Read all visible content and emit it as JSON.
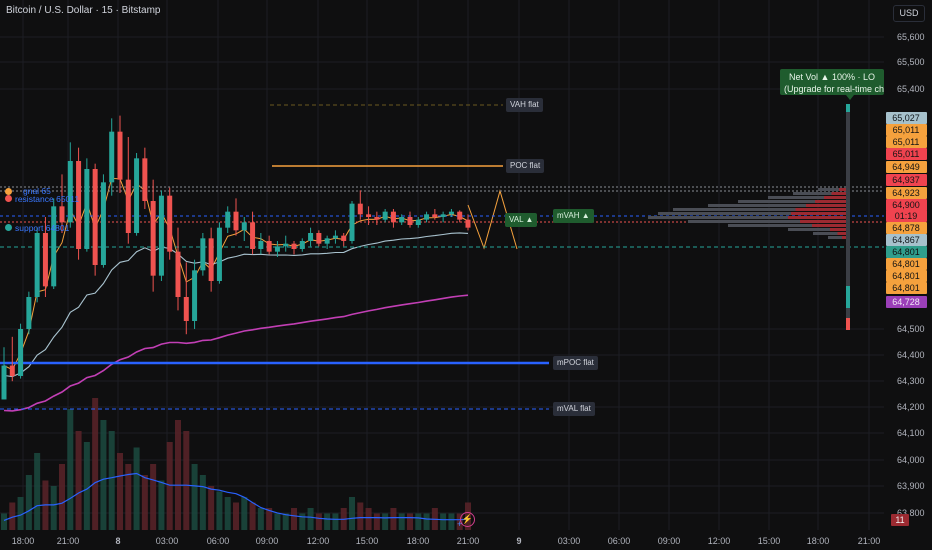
{
  "header": {
    "symbol_line": "Bitcoin / U.S. Dollar · 15 · Bitstamp",
    "currency_button": "USD"
  },
  "net_volume_badge": {
    "line1": "Net Vol ▲ 100%  ·  LO",
    "line2": "(Upgrade for real-time cha"
  },
  "level_labels": {
    "vah": "VAH flat",
    "poc": "POC flat",
    "val": "VAL ▲",
    "mvah": "mVAH ▲",
    "mpoc": "mPOC flat",
    "mval": "mVAL flat"
  },
  "alerts": {
    "resistance_text": "resistance 65011",
    "resistance_overlap": "gnal 65",
    "support_text": "support 64801"
  },
  "price_tags": [
    {
      "text": "65,027",
      "bg": "#a6c1cc",
      "fg": "#10161a"
    },
    {
      "text": "65,011",
      "bg": "#f5a13d",
      "fg": "#141414"
    },
    {
      "text": "65,011",
      "bg": "#f5a13d",
      "fg": "#141414"
    },
    {
      "text": "65,011",
      "bg": "#f0434f",
      "fg": "#141414"
    },
    {
      "text": "64,949",
      "bg": "#f5a13d",
      "fg": "#141414"
    },
    {
      "text": "64,937",
      "bg": "#f0434f",
      "fg": "#141414"
    },
    {
      "text": "64,923",
      "bg": "#f5a13d",
      "fg": "#141414"
    },
    {
      "text": "64,900",
      "bg": "#f0434f",
      "fg": "#141414"
    },
    {
      "text": "01:19",
      "bg": "#f0434f",
      "fg": "#141414"
    },
    {
      "text": "64,878",
      "bg": "#f5a13d",
      "fg": "#141414"
    },
    {
      "text": "64,867",
      "bg": "#a6c1cc",
      "fg": "#10161a"
    },
    {
      "text": "64,801",
      "bg": "#2f9e8c",
      "fg": "#101010"
    },
    {
      "text": "64,801",
      "bg": "#f5a13d",
      "fg": "#141414"
    },
    {
      "text": "64,801",
      "bg": "#f5a13d",
      "fg": "#141414"
    },
    {
      "text": "64,801",
      "bg": "#f5a13d",
      "fg": "#141414"
    },
    {
      "text": "64,728",
      "bg": "#9b3fb8",
      "fg": "#f0e6f5"
    }
  ],
  "volume_tag": "11",
  "colors": {
    "up": "#26a69a",
    "down": "#ef5350",
    "ema_fast": "#f5a13d",
    "ema_mid": "#a6c1cc",
    "ema_slow": "#c23fb5",
    "mpoc": "#2962ff",
    "volume_ma": "#2962ff"
  },
  "chart_data": {
    "type": "candlestick",
    "title": "Bitcoin / U.S. Dollar · 15 · Bitstamp",
    "y_ticks": [
      "65,600",
      "65,500",
      "65,400",
      "64,500",
      "64,400",
      "64,300",
      "64,200",
      "64,100",
      "64,000",
      "63,900",
      "63,800"
    ],
    "x_ticks": [
      "18:00",
      "21:00",
      "8",
      "03:00",
      "06:00",
      "09:00",
      "12:00",
      "15:00",
      "18:00",
      "21:00",
      "9",
      "03:00",
      "06:00",
      "09:00",
      "12:00",
      "15:00",
      "18:00",
      "21:00"
    ],
    "ylim": [
      63750,
      65650
    ],
    "candles": [
      [
        64230,
        64430,
        64230,
        64360
      ],
      [
        64360,
        64470,
        64300,
        64320
      ],
      [
        64320,
        64520,
        64310,
        64500
      ],
      [
        64500,
        64640,
        64480,
        64620
      ],
      [
        64620,
        64880,
        64600,
        64860
      ],
      [
        64860,
        64920,
        64620,
        64660
      ],
      [
        64660,
        64990,
        64650,
        64960
      ],
      [
        64960,
        65080,
        64860,
        64900
      ],
      [
        64900,
        65200,
        64880,
        65130
      ],
      [
        65130,
        65180,
        64760,
        64800
      ],
      [
        64800,
        65140,
        64790,
        65100
      ],
      [
        65100,
        65120,
        64700,
        64740
      ],
      [
        64740,
        65080,
        64730,
        65050
      ],
      [
        65050,
        65290,
        65000,
        65240
      ],
      [
        65240,
        65300,
        65010,
        65060
      ],
      [
        65060,
        65220,
        64820,
        64860
      ],
      [
        64860,
        65160,
        64850,
        65140
      ],
      [
        65140,
        65180,
        64950,
        64980
      ],
      [
        64980,
        65060,
        64640,
        64700
      ],
      [
        64700,
        65020,
        64680,
        65000
      ],
      [
        65000,
        65030,
        64760,
        64790
      ],
      [
        64790,
        64880,
        64570,
        64620
      ],
      [
        64620,
        64750,
        64480,
        64530
      ],
      [
        64530,
        64760,
        64500,
        64720
      ],
      [
        64720,
        64860,
        64700,
        64840
      ],
      [
        64840,
        64880,
        64640,
        64680
      ],
      [
        64680,
        64900,
        64670,
        64880
      ],
      [
        64880,
        64960,
        64860,
        64940
      ],
      [
        64940,
        64990,
        64850,
        64870
      ],
      [
        64870,
        64920,
        64830,
        64900
      ],
      [
        64900,
        64940,
        64780,
        64800
      ],
      [
        64800,
        64860,
        64780,
        64830
      ],
      [
        64830,
        64850,
        64780,
        64790
      ],
      [
        64790,
        64830,
        64770,
        64810
      ],
      [
        64810,
        64850,
        64790,
        64820
      ],
      [
        64820,
        64830,
        64780,
        64800
      ],
      [
        64800,
        64840,
        64790,
        64830
      ],
      [
        64830,
        64880,
        64810,
        64860
      ],
      [
        64860,
        64870,
        64810,
        64820
      ],
      [
        64820,
        64850,
        64800,
        64840
      ],
      [
        64840,
        64870,
        64820,
        64850
      ],
      [
        64850,
        64860,
        64810,
        64830
      ],
      [
        64830,
        64980,
        64820,
        64970
      ],
      [
        64970,
        65020,
        64910,
        64930
      ],
      [
        64930,
        64960,
        64890,
        64920
      ],
      [
        64920,
        64940,
        64890,
        64910
      ],
      [
        64910,
        64950,
        64900,
        64940
      ],
      [
        64940,
        64950,
        64880,
        64900
      ],
      [
        64900,
        64930,
        64890,
        64920
      ],
      [
        64920,
        64940,
        64880,
        64890
      ],
      [
        64890,
        64920,
        64880,
        64910
      ],
      [
        64910,
        64940,
        64900,
        64930
      ],
      [
        64930,
        64950,
        64910,
        64920
      ],
      [
        64920,
        64940,
        64900,
        64930
      ],
      [
        64930,
        64950,
        64920,
        64940
      ],
      [
        64940,
        64945,
        64900,
        64910
      ],
      [
        64910,
        64930,
        64870,
        64880
      ]
    ],
    "volume": [
      3,
      5,
      6,
      10,
      14,
      9,
      8,
      12,
      22,
      18,
      16,
      24,
      20,
      18,
      14,
      12,
      15,
      10,
      12,
      9,
      16,
      20,
      18,
      12,
      10,
      8,
      7,
      6,
      5,
      6,
      5,
      4,
      4,
      3,
      3,
      4,
      3,
      4,
      3,
      3,
      3,
      4,
      6,
      5,
      4,
      3,
      3,
      4,
      3,
      3,
      3,
      3,
      4,
      3,
      3,
      3,
      5
    ],
    "levels": {
      "vah": 65545,
      "poc": 65480,
      "val": 65040,
      "mvah": 65050,
      "mpoc": 64385,
      "mval": 64215,
      "resistance": 65011,
      "support": 64801,
      "last": 64900
    }
  }
}
